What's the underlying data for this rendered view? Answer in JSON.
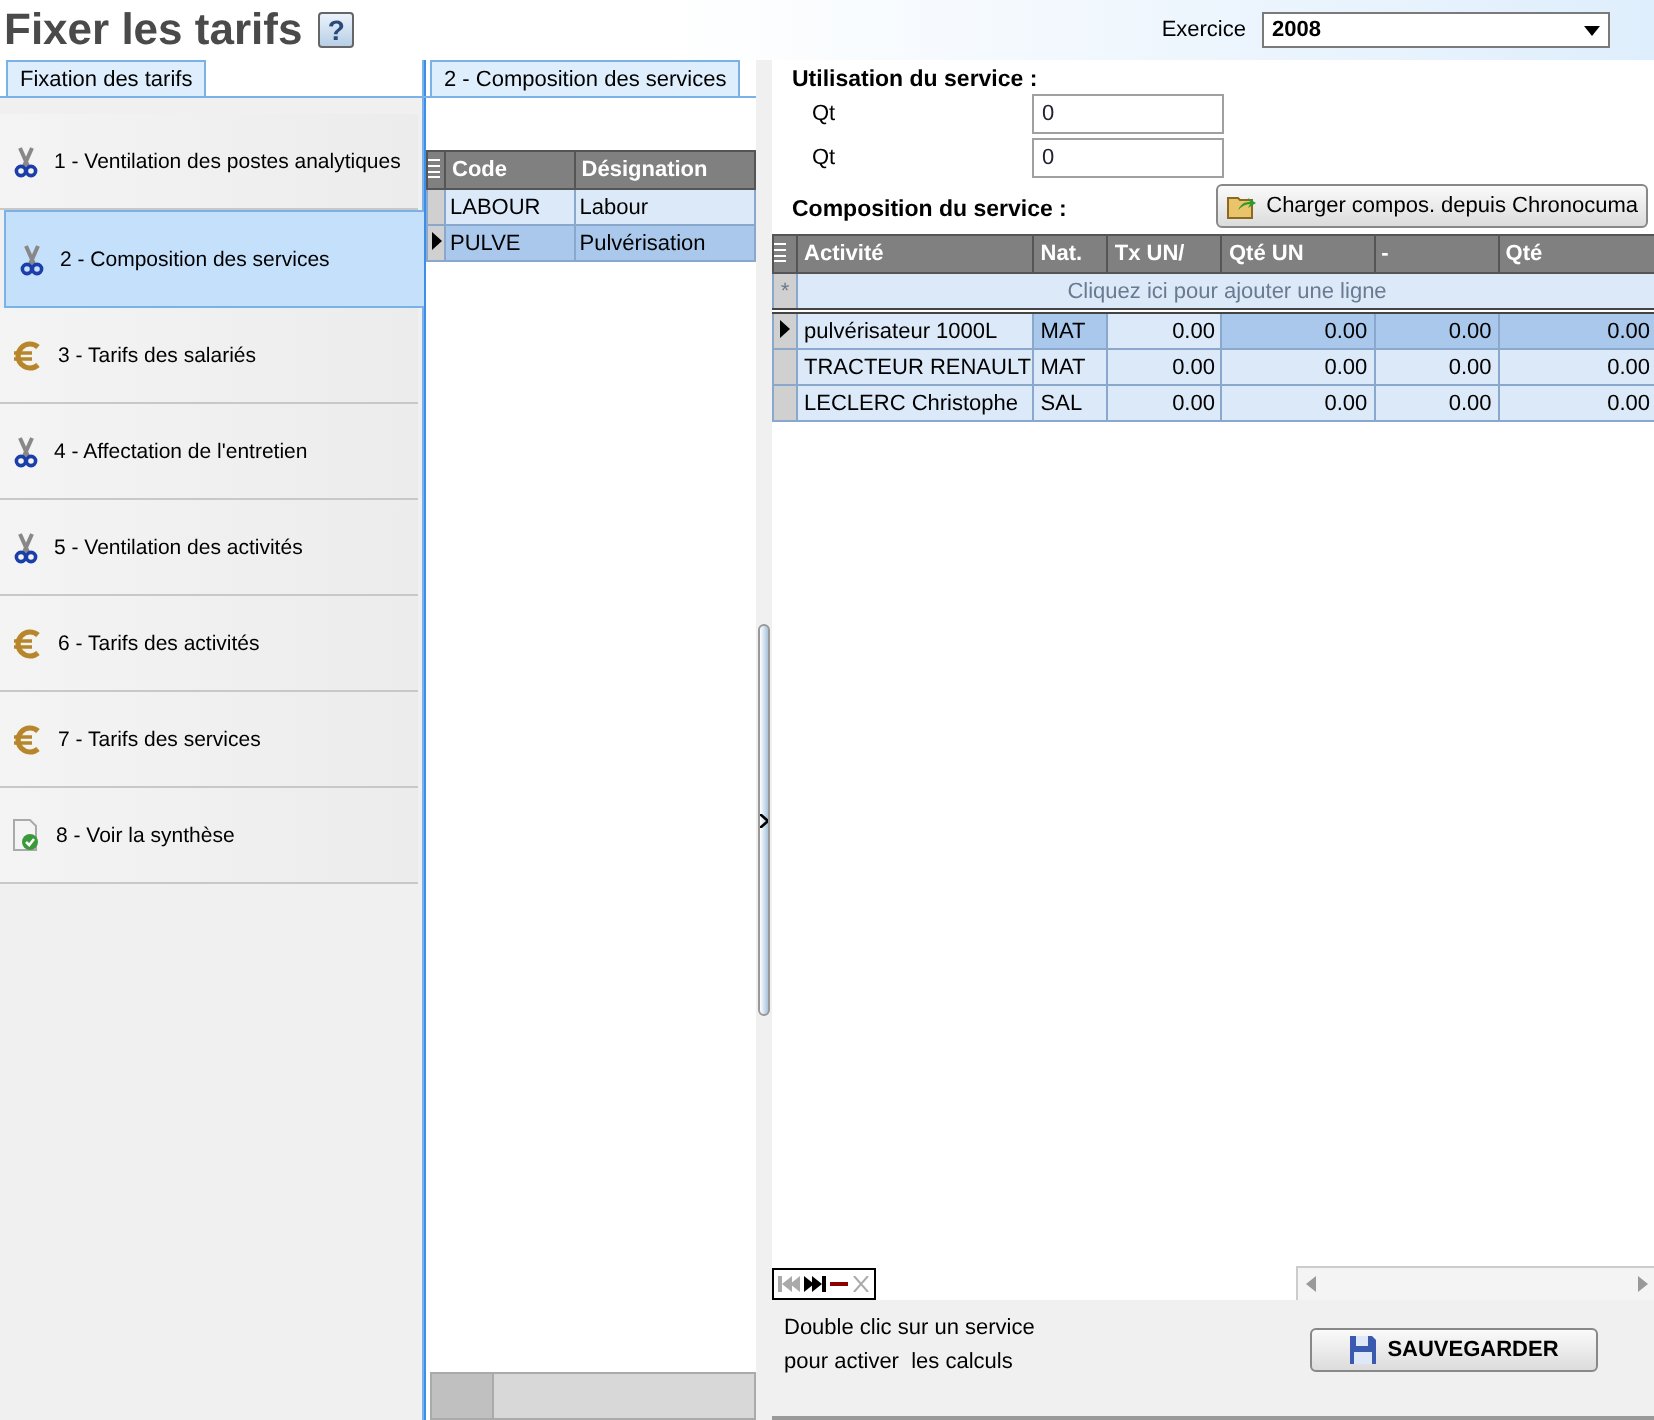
{
  "header": {
    "title": "Fixer les tarifs",
    "help": "?",
    "exercice_label": "Exercice",
    "exercice_value": "2008"
  },
  "left_tab": {
    "label": "Fixation des tarifs"
  },
  "steps": [
    {
      "label": "1 - Ventilation des postes analytiques",
      "kind": "scissors",
      "selected": false
    },
    {
      "label": "2 - Composition des services",
      "kind": "scissors",
      "selected": true
    },
    {
      "label": "3 - Tarifs des salariés",
      "kind": "euro",
      "selected": false
    },
    {
      "label": "4 - Affectation de l'entretien",
      "kind": "scissors",
      "selected": false
    },
    {
      "label": "5 - Ventilation des activités",
      "kind": "scissors",
      "selected": false
    },
    {
      "label": "6 - Tarifs des activités",
      "kind": "euro",
      "selected": false
    },
    {
      "label": "7 - Tarifs des services",
      "kind": "euro",
      "selected": false
    },
    {
      "label": "8 - Voir la synthèse",
      "kind": "report",
      "selected": false
    }
  ],
  "middle_tab": {
    "label": "2 - Composition des services"
  },
  "services": {
    "columns": [
      "Code",
      "Désignation"
    ],
    "rows": [
      {
        "code": "LABOUR",
        "designation": "Labour",
        "selected": false
      },
      {
        "code": "PULVE",
        "designation": "Pulvérisation",
        "selected": true
      }
    ]
  },
  "utilisation": {
    "title": "Utilisation du service :",
    "fields": [
      {
        "label": "Qt",
        "value": "0"
      },
      {
        "label": "Qt",
        "value": "0"
      }
    ]
  },
  "composition": {
    "title": "Composition du service :",
    "load_button": "Charger compos. depuis Chronocuma",
    "columns": [
      "Activité",
      "Nat.",
      "Tx UN/",
      "Qté UN",
      "-",
      "Qté"
    ],
    "new_row_marker": "*",
    "new_row_hint": "Cliquez ici pour ajouter une ligne",
    "rows": [
      {
        "cells": [
          "pulvérisateur 1000L",
          "MAT",
          "0.00",
          "0.00",
          "0.00",
          "0.00"
        ],
        "selected": true
      },
      {
        "cells": [
          "TRACTEUR RENAULT",
          "MAT",
          "0.00",
          "0.00",
          "0.00",
          "0.00"
        ],
        "selected": false
      },
      {
        "cells": [
          "LECLERC Christophe",
          "SAL",
          "0.00",
          "0.00",
          "0.00",
          "0.00"
        ],
        "selected": false
      }
    ]
  },
  "hint_lines": [
    "Double clic sur un service",
    "pour activer  les calculs"
  ],
  "save_button": "SAUVEGARDER"
}
